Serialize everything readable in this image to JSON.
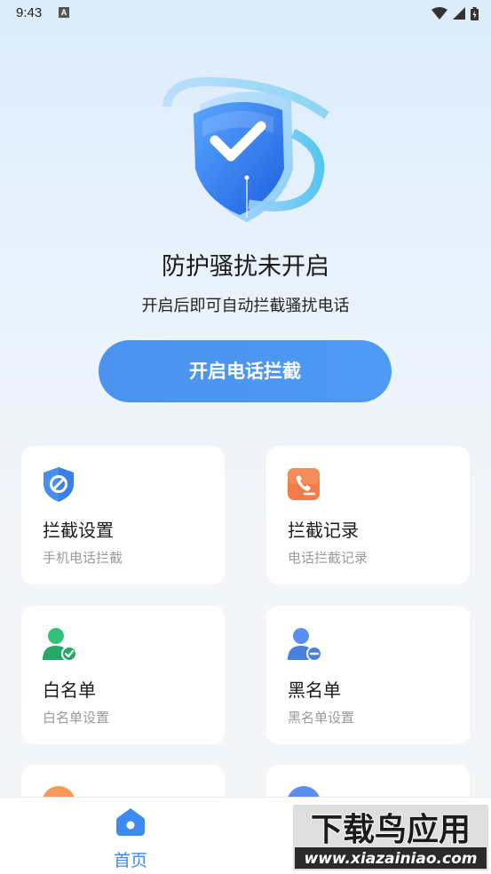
{
  "status": {
    "time": "9:43",
    "notif": "A"
  },
  "hero": {
    "title": "防护骚扰未开启",
    "subtitle": "开启后即可自动拦截骚扰电话",
    "button": "开启电话拦截"
  },
  "cards": [
    {
      "title": "拦截设置",
      "subtitle": "手机电话拦截",
      "icon": "shield-block-icon"
    },
    {
      "title": "拦截记录",
      "subtitle": "电话拦截记录",
      "icon": "phone-record-icon"
    },
    {
      "title": "白名单",
      "subtitle": "白名单设置",
      "icon": "user-check-icon"
    },
    {
      "title": "黑名单",
      "subtitle": "黑名单设置",
      "icon": "user-minus-icon"
    }
  ],
  "nav": {
    "home": "首页"
  },
  "watermark": {
    "title": "下载鸟应用",
    "url": "www.xiazainiao.com"
  },
  "colors": {
    "accent": "#4b93ef",
    "orange": "#f47c4a",
    "green": "#33c07a",
    "blue_user": "#5a8ff0"
  }
}
